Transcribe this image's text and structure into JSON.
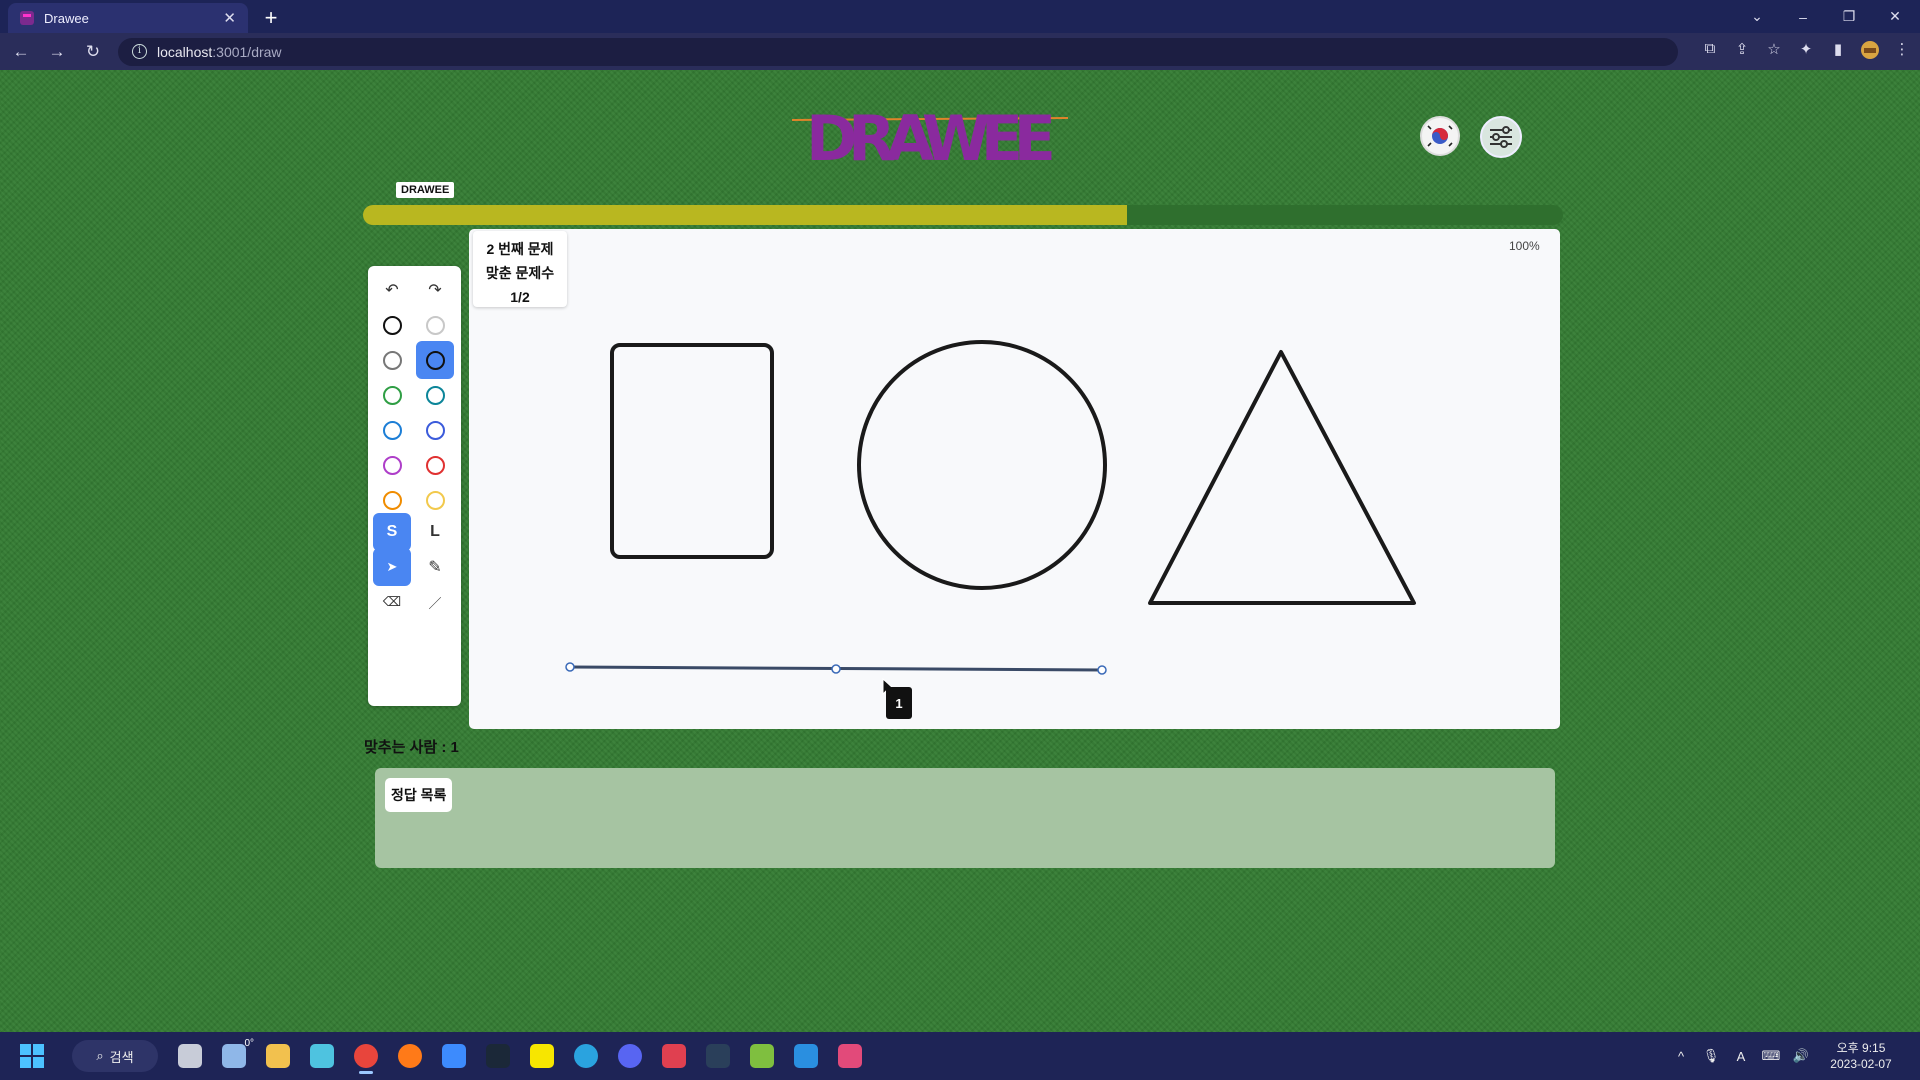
{
  "browser": {
    "tab_title": "Drawee",
    "tab_close": "✕",
    "new_tab": "+",
    "url_host": "localhost",
    "url_path": ":3001/draw",
    "info_glyph": "i",
    "nav": {
      "back": "←",
      "forward": "→",
      "reload": "↻"
    },
    "window": {
      "tabs_menu": "⌄",
      "minimize": "–",
      "restore": "❐",
      "close": "✕"
    },
    "toolbar_icons": [
      "open-in-app-icon",
      "share-icon",
      "bookmark-star-icon",
      "extensions-icon",
      "side-panel-icon",
      "profile-icon",
      "menu-icon"
    ],
    "toolbar_glyphs": {
      "open_in_app": "⧉",
      "share": "⇪",
      "bookmark": "☆",
      "extensions": "✦",
      "side_panel": "▮",
      "menu": "⋮"
    }
  },
  "app": {
    "logo_text": "DRAWEE",
    "progress_label": "DRAWEE",
    "progress_fraction": 0.637,
    "question": {
      "line1": "2 번째 문제",
      "line2": "맞춘 문제수",
      "line3": "1/2"
    },
    "zoom": "100%",
    "tools": {
      "undo": "↶",
      "redo": "↷",
      "size_small": "S",
      "size_large": "L",
      "select": "➤",
      "pen": "✎",
      "eraser": "⌫",
      "line": "／",
      "colors": [
        "#111111",
        "#c8c8c8",
        "#777777",
        "#111111",
        "#2f9e44",
        "#0c8599",
        "#1c7ed6",
        "#3b5bdb",
        "#ae3ec9",
        "#e03131",
        "#f08c00",
        "#f2c94c"
      ],
      "active_color_index": 3
    },
    "cursor_tooltip": "1",
    "answerers": "맞추는 사람 : 1",
    "answer_list_label": "정답 목록"
  },
  "taskbar": {
    "search_label": "검색",
    "search_glyph": "⌕",
    "weather": "0°",
    "tray": {
      "chevron": "^",
      "mic": "🎙",
      "ime": "A",
      "network": "⌨",
      "volume": "🔊"
    },
    "time_line1": "오후 9:15",
    "time_line2": "2023-02-07",
    "apps": [
      {
        "name": "task-view-icon",
        "color": "#c8ccd8"
      },
      {
        "name": "weather-icon",
        "color": "#8fb7e8"
      },
      {
        "name": "file-explorer-icon",
        "color": "#f2c14e"
      },
      {
        "name": "app-bird-icon",
        "color": "#4ec3e0"
      },
      {
        "name": "chrome-icon",
        "color": "#e8453c"
      },
      {
        "name": "firefox-icon",
        "color": "#ff7a18"
      },
      {
        "name": "app-blue-icon",
        "color": "#3d8bfd"
      },
      {
        "name": "steam-icon",
        "color": "#1b2838"
      },
      {
        "name": "kakaotalk-icon",
        "color": "#f7e600"
      },
      {
        "name": "telegram-icon",
        "color": "#2aa3df"
      },
      {
        "name": "discord-icon",
        "color": "#5865f2"
      },
      {
        "name": "app-red-icon",
        "color": "#e04050"
      },
      {
        "name": "steam-2-icon",
        "color": "#2a3f5a"
      },
      {
        "name": "git-icon",
        "color": "#7fbf3f"
      },
      {
        "name": "vscode-icon",
        "color": "#2a8fe0"
      },
      {
        "name": "snipping-icon",
        "color": "#e24a7a"
      }
    ],
    "active_app_index": 4
  }
}
